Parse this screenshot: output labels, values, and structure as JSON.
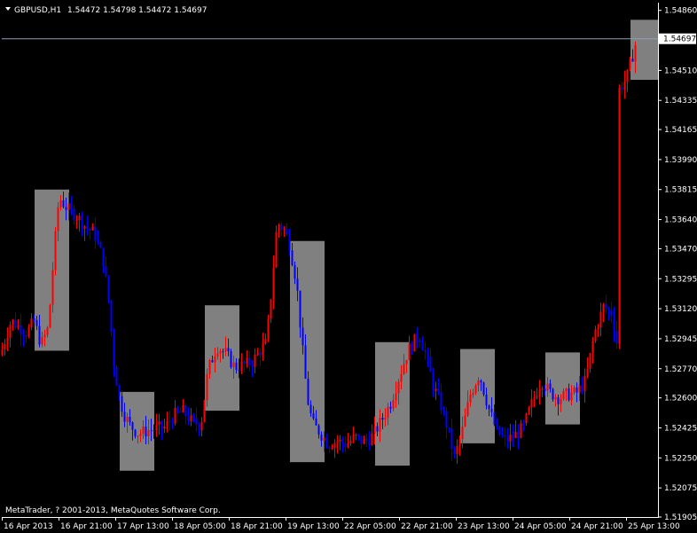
{
  "window": {
    "symbol_title": "GBPUSD,H1",
    "ohlc_text": "1.54472 1.54798 1.54472 1.54697",
    "copyright": "MetaTrader, ? 2001-2013, MetaQuotes Software Corp."
  },
  "colors": {
    "background": "#000000",
    "bull": "#ff0000",
    "bear": "#0000ff",
    "box": "#808080",
    "axis": "#ffffff",
    "bid_line": "#8fa0b6"
  },
  "chart_data": {
    "type": "candlestick",
    "symbol": "GBPUSD",
    "timeframe": "H1",
    "current_price": 1.54697,
    "current_price_label": "1.54697",
    "y_ticks": [
      "1.54860",
      "1.54510",
      "1.54335",
      "1.54165",
      "1.53990",
      "1.53815",
      "1.53640",
      "1.53470",
      "1.53295",
      "1.53120",
      "1.52945",
      "1.52770",
      "1.52600",
      "1.52425",
      "1.52250",
      "1.52075",
      "1.51905"
    ],
    "ylim": [
      1.51905,
      1.54905
    ],
    "x_ticks": [
      "16 Apr 2013",
      "16 Apr 21:00",
      "17 Apr 13:00",
      "18 Apr 05:00",
      "18 Apr 21:00",
      "19 Apr 13:00",
      "22 Apr 05:00",
      "22 Apr 21:00",
      "23 Apr 13:00",
      "24 Apr 05:00",
      "24 Apr 21:00",
      "25 Apr 13:00"
    ],
    "price_path": [
      [
        0,
        1.5285
      ],
      [
        12,
        1.5305
      ],
      [
        30,
        1.5298
      ],
      [
        38,
        1.5305
      ],
      [
        46,
        1.5291
      ],
      [
        54,
        1.5301
      ],
      [
        60,
        1.5342
      ],
      [
        66,
        1.5377
      ],
      [
        76,
        1.537
      ],
      [
        86,
        1.5366
      ],
      [
        96,
        1.536
      ],
      [
        106,
        1.5356
      ],
      [
        116,
        1.534
      ],
      [
        122,
        1.5317
      ],
      [
        128,
        1.528
      ],
      [
        134,
        1.526
      ],
      [
        140,
        1.525
      ],
      [
        146,
        1.5244
      ],
      [
        156,
        1.5239
      ],
      [
        166,
        1.5241
      ],
      [
        176,
        1.5242
      ],
      [
        186,
        1.5243
      ],
      [
        196,
        1.525
      ],
      [
        206,
        1.5252
      ],
      [
        216,
        1.5246
      ],
      [
        226,
        1.5244
      ],
      [
        234,
        1.5276
      ],
      [
        244,
        1.529
      ],
      [
        254,
        1.5286
      ],
      [
        264,
        1.5278
      ],
      [
        274,
        1.5279
      ],
      [
        284,
        1.5281
      ],
      [
        292,
        1.5287
      ],
      [
        300,
        1.5292
      ],
      [
        306,
        1.5325
      ],
      [
        312,
        1.5362
      ],
      [
        320,
        1.5358
      ],
      [
        326,
        1.535
      ],
      [
        334,
        1.5327
      ],
      [
        340,
        1.5292
      ],
      [
        346,
        1.526
      ],
      [
        352,
        1.5245
      ],
      [
        360,
        1.524
      ],
      [
        370,
        1.5233
      ],
      [
        380,
        1.5235
      ],
      [
        390,
        1.5233
      ],
      [
        400,
        1.5237
      ],
      [
        410,
        1.5234
      ],
      [
        420,
        1.5238
      ],
      [
        430,
        1.5247
      ],
      [
        440,
        1.5257
      ],
      [
        450,
        1.5273
      ],
      [
        460,
        1.5288
      ],
      [
        472,
        1.5297
      ],
      [
        480,
        1.5285
      ],
      [
        488,
        1.5267
      ],
      [
        496,
        1.5257
      ],
      [
        504,
        1.5243
      ],
      [
        512,
        1.5225
      ],
      [
        520,
        1.5239
      ],
      [
        530,
        1.5262
      ],
      [
        540,
        1.5274
      ],
      [
        550,
        1.5255
      ],
      [
        560,
        1.524
      ],
      [
        570,
        1.5235
      ],
      [
        580,
        1.5238
      ],
      [
        590,
        1.5243
      ],
      [
        600,
        1.5258
      ],
      [
        610,
        1.527
      ],
      [
        620,
        1.5263
      ],
      [
        630,
        1.526
      ],
      [
        640,
        1.5262
      ],
      [
        650,
        1.5263
      ],
      [
        660,
        1.527
      ],
      [
        670,
        1.5298
      ],
      [
        680,
        1.5313
      ],
      [
        690,
        1.5309
      ],
      [
        696,
        1.5289
      ],
      [
        698,
        1.544
      ],
      [
        706,
        1.5446
      ],
      [
        712,
        1.5458
      ],
      [
        718,
        1.547
      ]
    ],
    "highlight_boxes": [
      {
        "x0": 0,
        "x1": 0,
        "ylo": 1.52875,
        "yhi": 1.53815
      },
      {
        "x0": 0,
        "x1": 0,
        "ylo": 1.52175,
        "yhi": 1.52635
      },
      {
        "x0": 0,
        "x1": 0,
        "ylo": 1.52525,
        "yhi": 1.5314
      },
      {
        "x0": 0,
        "x1": 0,
        "ylo": 1.52225,
        "yhi": 1.53515
      },
      {
        "x0": 0,
        "x1": 0,
        "ylo": 1.52205,
        "yhi": 1.52925
      },
      {
        "x0": 0,
        "x1": 0,
        "ylo": 1.52335,
        "yhi": 1.52885
      },
      {
        "x0": 0,
        "x1": 0,
        "ylo": 1.52445,
        "yhi": 1.52865
      },
      {
        "x0": 0,
        "x1": 0,
        "ylo": 1.54455,
        "yhi": 1.54805
      }
    ]
  }
}
